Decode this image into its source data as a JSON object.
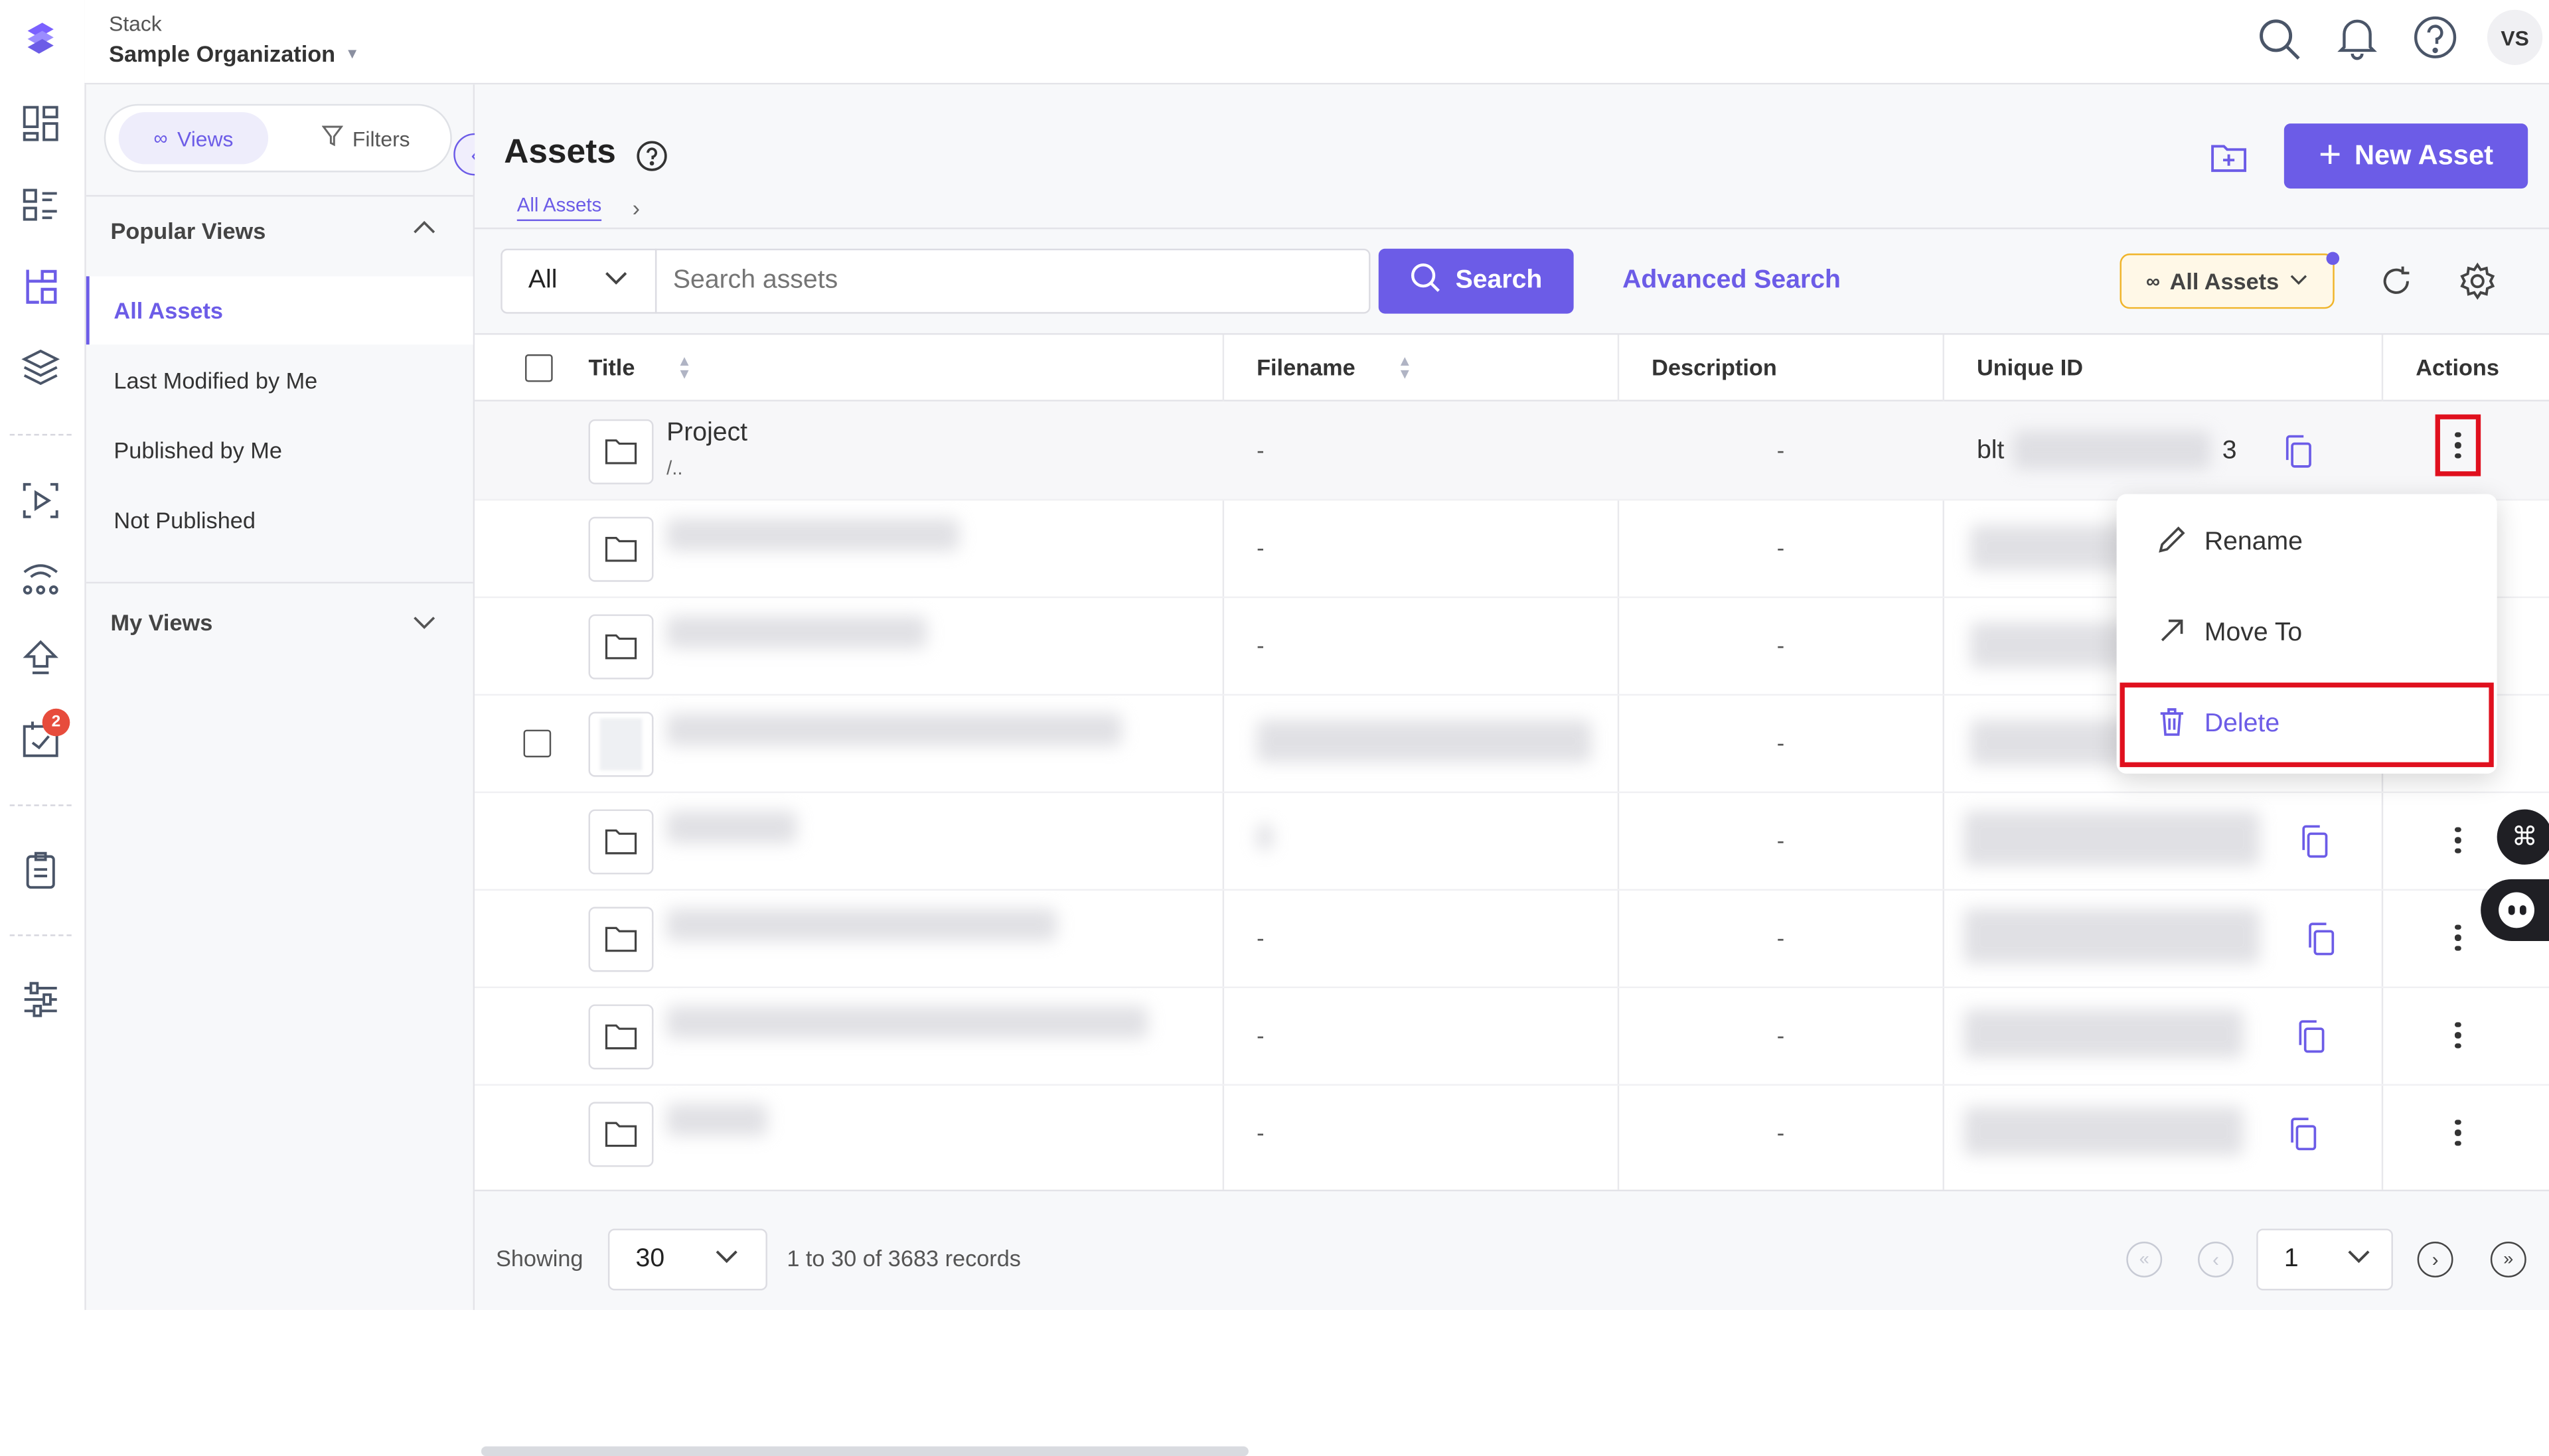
{
  "org": {
    "product": "Stack",
    "name": "Sample Organization"
  },
  "user": {
    "initials": "VS"
  },
  "rail": {
    "badge_count": "2"
  },
  "sidebar": {
    "tabs": {
      "views": "Views",
      "filters": "Filters"
    },
    "popular_title": "Popular Views",
    "popular_items": [
      "All Assets",
      "Last Modified by Me",
      "Published by Me",
      "Not Published"
    ],
    "my_views_title": "My Views"
  },
  "page": {
    "title": "Assets",
    "breadcrumb": "All Assets",
    "new_asset_label": "New Asset"
  },
  "search": {
    "scope": "All",
    "placeholder": "Search assets",
    "button": "Search",
    "advanced": "Advanced Search",
    "view_filter": "All Assets"
  },
  "table": {
    "columns": [
      "Title",
      "Filename",
      "Description",
      "Unique ID",
      "Actions"
    ],
    "first_row": {
      "title": "Project",
      "path": "/..",
      "filename": "-",
      "description": "-",
      "uid_prefix": "blt",
      "uid_suffix": "3"
    },
    "placeholder": "-"
  },
  "context_menu": {
    "items": [
      "Rename",
      "Move To",
      "Delete"
    ]
  },
  "footer": {
    "showing_label": "Showing",
    "page_size": "30",
    "records": "1 to 30 of 3683 records",
    "page_number": "1"
  },
  "colors": {
    "accent": "#6c5ce7",
    "highlight": "#e0101e",
    "filter_border": "#f0b429",
    "badge": "#e74c3c"
  }
}
